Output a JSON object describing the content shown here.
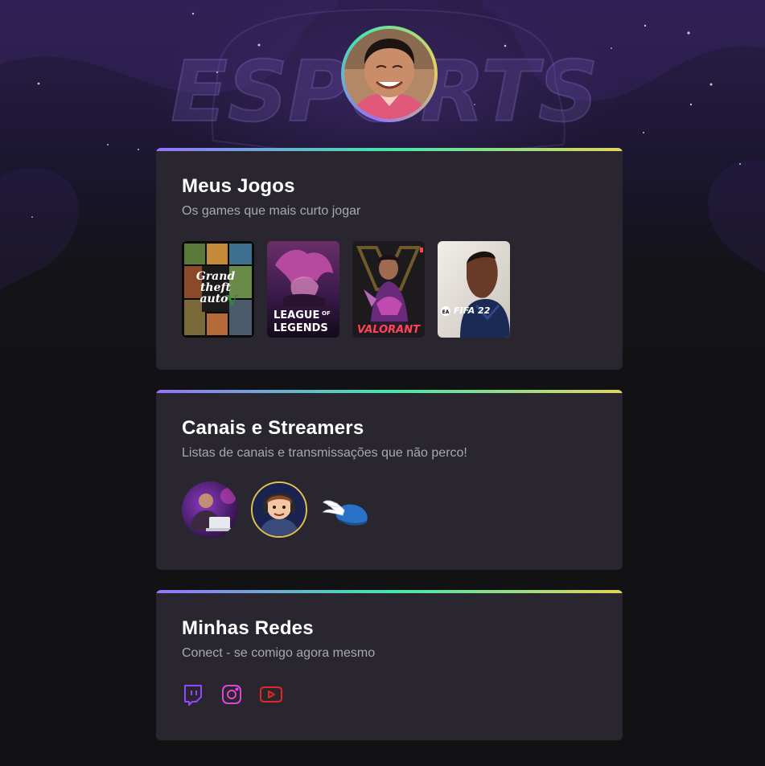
{
  "sections": {
    "games": {
      "title": "Meus Jogos",
      "subtitle": "Os games que mais curto jogar",
      "items": [
        {
          "name": "Grand Theft Auto V",
          "logo_lines": [
            "Grand",
            "theft",
            "auto"
          ],
          "logo_mark": "V"
        },
        {
          "name": "League of Legends",
          "logo_lines": [
            "LEAGUE",
            "OF",
            "LEGENDS"
          ]
        },
        {
          "name": "Valorant",
          "logo": "VALORANT"
        },
        {
          "name": "FIFA 22",
          "logo": "FIFA 22",
          "badge": "EA"
        }
      ]
    },
    "streamers": {
      "title": "Canais e Streamers",
      "subtitle": "Listas de canais e transmissações que não perco!"
    },
    "socials": {
      "title": "Minhas Redes",
      "subtitle": "Conect - se comigo agora mesmo",
      "items": [
        {
          "icon": "twitch-icon",
          "color": "#9146ff"
        },
        {
          "icon": "instagram-icon",
          "color": "#e047d4"
        },
        {
          "icon": "youtube-icon",
          "color": "#e02626"
        }
      ]
    }
  },
  "hero": {
    "background_text": "ESPORTS"
  },
  "colors": {
    "page_bg": "#121214",
    "card_bg": "#29262f",
    "title": "#ffffff",
    "subtitle": "#a8a8b3",
    "gradient": [
      "#9572fc",
      "#43e7ad",
      "#e2d45c"
    ]
  }
}
